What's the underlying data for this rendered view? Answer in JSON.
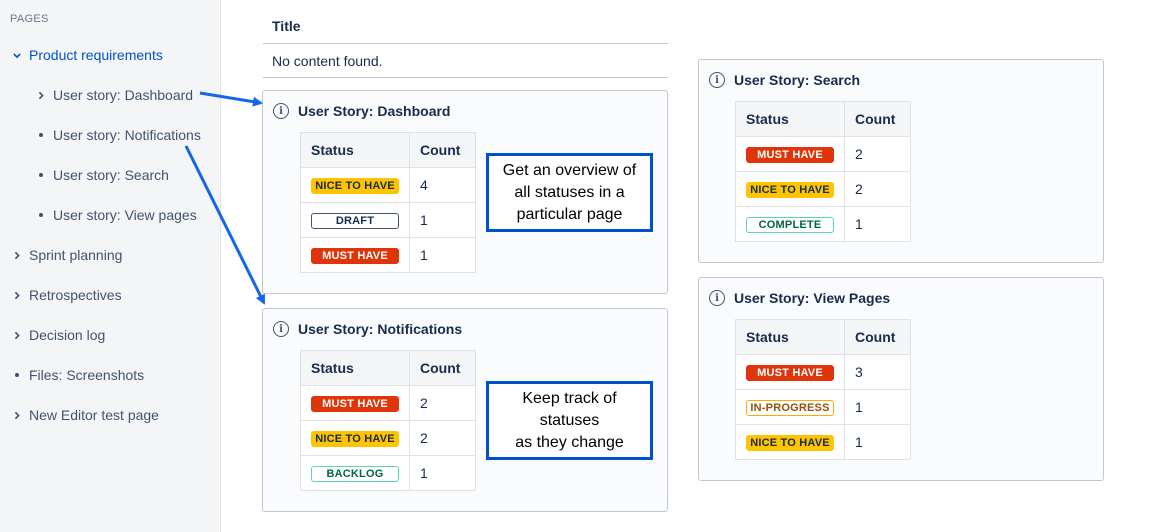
{
  "sidebar": {
    "heading": "PAGES",
    "items": [
      {
        "label": "Product requirements",
        "marker": "chevron-down"
      },
      {
        "label": "User story: Dashboard",
        "marker": "chevron-right"
      },
      {
        "label": "User story: Notifications",
        "marker": "bullet"
      },
      {
        "label": "User story: Search",
        "marker": "bullet"
      },
      {
        "label": "User story: View pages",
        "marker": "bullet"
      },
      {
        "label": "Sprint planning",
        "marker": "chevron-right"
      },
      {
        "label": "Retrospectives",
        "marker": "chevron-right"
      },
      {
        "label": "Decision log",
        "marker": "chevron-right"
      },
      {
        "label": "Files: Screenshots",
        "marker": "bullet"
      },
      {
        "label": "New Editor test page",
        "marker": "chevron-right"
      }
    ]
  },
  "title_table": {
    "header": "Title",
    "empty_message": "No content found."
  },
  "table_headers": {
    "status": "Status",
    "count": "Count"
  },
  "panels": {
    "dashboard": {
      "title": "User Story: Dashboard",
      "rows": [
        {
          "status": "NICE TO HAVE",
          "count": "4"
        },
        {
          "status": "DRAFT",
          "count": "1"
        },
        {
          "status": "MUST HAVE",
          "count": "1"
        }
      ]
    },
    "notifications": {
      "title": "User Story: Notifications",
      "rows": [
        {
          "status": "MUST HAVE",
          "count": "2"
        },
        {
          "status": "NICE TO HAVE",
          "count": "2"
        },
        {
          "status": "BACKLOG",
          "count": "1"
        }
      ]
    },
    "search": {
      "title": "User Story: Search",
      "rows": [
        {
          "status": "MUST HAVE",
          "count": "2"
        },
        {
          "status": "NICE TO HAVE",
          "count": "2"
        },
        {
          "status": "COMPLETE",
          "count": "1"
        }
      ]
    },
    "view_pages": {
      "title": "User Story: View Pages",
      "rows": [
        {
          "status": "MUST HAVE",
          "count": "3"
        },
        {
          "status": "IN-PROGRESS",
          "count": "1"
        },
        {
          "status": "NICE TO HAVE",
          "count": "1"
        }
      ]
    }
  },
  "callouts": {
    "overview": {
      "lines": [
        "Get an overview of",
        "all statuses in a",
        "particular page"
      ]
    },
    "track": {
      "lines": [
        "Keep track of",
        "statuses",
        "as they change"
      ]
    }
  },
  "colors": {
    "accent": "#0052cc",
    "must_have": "#de350b",
    "nice_to_have": "#ffc400",
    "complete": "#57d9a3"
  }
}
